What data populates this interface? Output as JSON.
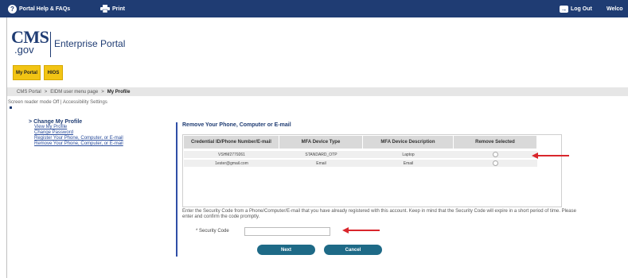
{
  "topbar": {
    "help_label": "Portal Help & FAQs",
    "print_label": "Print",
    "logout_label": "Log Out",
    "welcome_label": "Welco"
  },
  "logo": {
    "cms": "CMS",
    "gov": ".gov",
    "portal_title": "Enterprise Portal"
  },
  "tabs": {
    "my_portal": "My Portal",
    "hios": "HIOS"
  },
  "breadcrumb": {
    "item1": "CMS Portal",
    "sep": ">",
    "item2": "EIDM user menu page",
    "current": "My Profile"
  },
  "accessibility": {
    "text": "Screen reader mode Off | Accessibility Settings"
  },
  "menu": {
    "heading": "Change My Profile",
    "links": [
      "View My Profile",
      "Change Password",
      "Register Your Phone, Computer, or E-mail",
      "Remove Your Phone, Computer, or E-mail"
    ]
  },
  "section": {
    "title": "Remove Your Phone, Computer or E-mail"
  },
  "table": {
    "headers": [
      "Credential ID/Phone Number/E-mail",
      "MFA Device Type",
      "MFA Device Description",
      "Remove Selected"
    ],
    "rows": [
      {
        "id": "VSHM2779261",
        "type": "STANDARD_OTP",
        "desc": "Laptop"
      },
      {
        "id": "1ester@gmail.com",
        "type": "Email",
        "desc": "Email"
      }
    ]
  },
  "instructions": "Enter the Security Code from a Phone/Computer/E-mail that you have already registered with this account. Keep in mind that the Security Code will expire in a short period of time. Please enter and confirm the code promptly.",
  "form": {
    "security_label": "* Security Code",
    "security_value": "",
    "next_label": "Next",
    "cancel_label": "Cancel"
  },
  "colors": {
    "navy": "#1f3c73",
    "tab_yellow": "#f2c414",
    "button_teal": "#1e6a87",
    "arrow_red": "#d9262c"
  },
  "icons": {
    "help": "question-circle-icon",
    "print": "printer-icon",
    "logout": "logout-icon"
  }
}
